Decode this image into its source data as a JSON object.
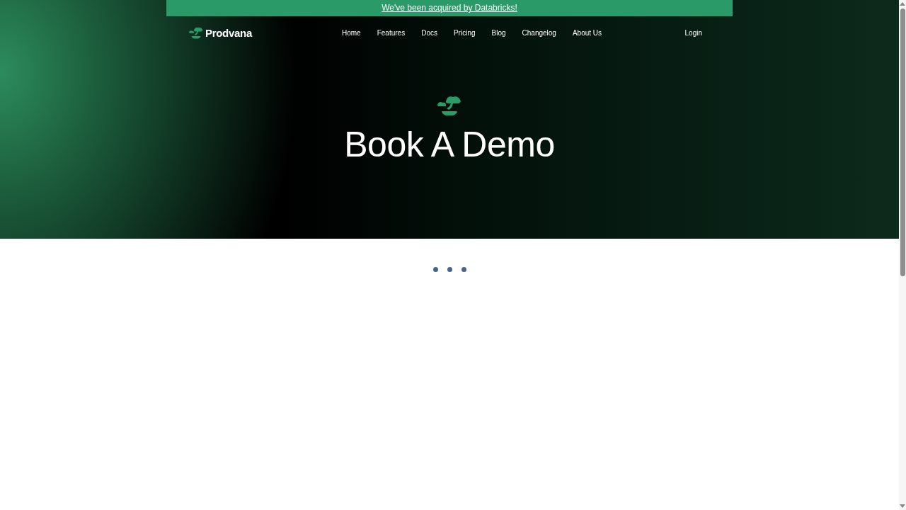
{
  "announcement": {
    "text": "We've been acquired by Databricks!"
  },
  "nav": {
    "brand": "Prodvana",
    "links": [
      {
        "label": "Home"
      },
      {
        "label": "Features"
      },
      {
        "label": "Docs"
      },
      {
        "label": "Pricing"
      },
      {
        "label": "Blog"
      },
      {
        "label": "Changelog"
      },
      {
        "label": "About Us"
      }
    ],
    "login": "Login"
  },
  "hero": {
    "title": "Book A Demo"
  },
  "loading": {
    "dots": [
      {
        "kind": "dot"
      },
      {
        "kind": "dot"
      },
      {
        "kind": "dot"
      }
    ]
  }
}
